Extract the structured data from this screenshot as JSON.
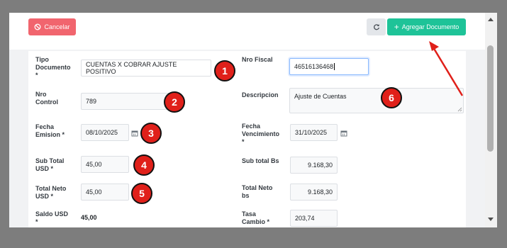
{
  "toolbar": {
    "cancel_label": "Cancelar",
    "add_label": "Agregar Documento"
  },
  "form": {
    "tipo_documento": {
      "label_1": "Tipo",
      "label_2": "Documento",
      "label_3": "*",
      "value": "CUENTAS X COBRAR AJUSTE POSITIVO"
    },
    "nro_fiscal": {
      "label": "Nro Fiscal",
      "value": "46516136468"
    },
    "nro_control": {
      "label_1": "Nro",
      "label_2": "Control",
      "value": "789"
    },
    "descripcion": {
      "label": "Descripcion",
      "value": "Ajuste de Cuentas"
    },
    "fecha_emision": {
      "label_1": "Fecha",
      "label_2": "Emision *",
      "value": "08/10/2025"
    },
    "fecha_vencimiento": {
      "label_1": "Fecha",
      "label_2": "Vencimiento",
      "label_3": "*",
      "value": "31/10/2025"
    },
    "sub_total_usd": {
      "label_1": "Sub Total",
      "label_2": "USD *",
      "value": "45,00"
    },
    "sub_total_bs": {
      "label": "Sub total Bs",
      "value": "9.168,30"
    },
    "total_neto_usd": {
      "label_1": "Total Neto",
      "label_2": "USD *",
      "value": "45,00"
    },
    "total_neto_bs": {
      "label_1": "Total Neto",
      "label_2": "bs",
      "value": "9.168,30"
    },
    "saldo_usd": {
      "label_1": "Saldo USD",
      "label_2": "*",
      "value": "45,00"
    },
    "tasa_cambio": {
      "label_1": "Tasa",
      "label_2": "Cambio *",
      "value": "203,74"
    }
  },
  "markers": [
    "1",
    "2",
    "3",
    "4",
    "5",
    "6"
  ],
  "colors": {
    "cancel": "#f1656e",
    "add": "#1ec398",
    "marker": "#e0201a",
    "arrow": "#e0201a"
  },
  "icons": {
    "cancel": "ban-icon",
    "refresh": "refresh-icon",
    "add": "plus-icon",
    "calendar": "calendar-icon"
  }
}
